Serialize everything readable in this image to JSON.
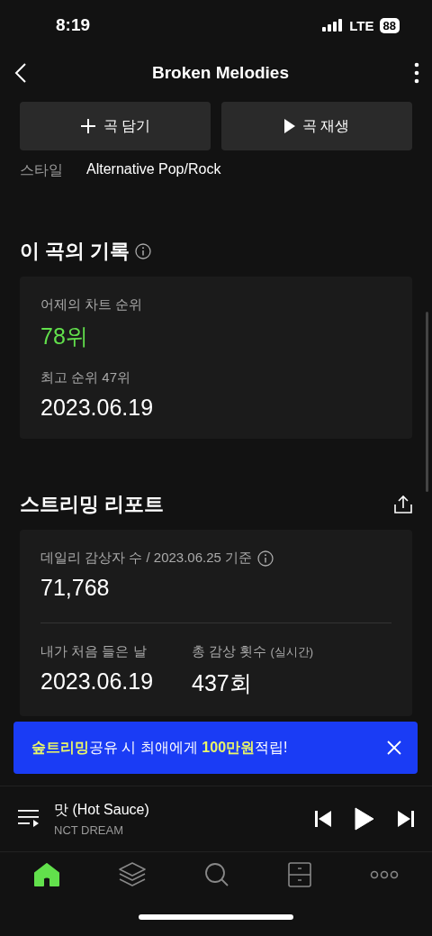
{
  "status_bar": {
    "time": "8:19",
    "network": "LTE",
    "battery": "88"
  },
  "header": {
    "title": "Broken Melodies"
  },
  "actions": [
    {
      "label": "곡 담기",
      "kind": "add"
    },
    {
      "label": "곡 재생",
      "kind": "play"
    }
  ],
  "style_row": {
    "label": "스타일",
    "value": "Alternative Pop/Rock"
  },
  "record": {
    "title": "이 곡의 기록",
    "yesterday_label": "어제의 차트 순위",
    "yesterday_rank": "78위",
    "peak_label": "최고 순위 47위",
    "peak_date": "2023.06.19"
  },
  "streaming_report": {
    "title": "스트리밍 리포트",
    "daily_label": "데일리 감상자 수 / 2023.06.25 기준",
    "daily_value": "71,768",
    "first_label": "내가 처음 들은 날",
    "first_value": "2023.06.19",
    "total_label": "총 감상 횟수",
    "total_note": "(실시간)",
    "total_value": "437회"
  },
  "banner": {
    "text": "**숲트리밍**공유 시 최애에게 **100만원**적립!"
  },
  "now_playing": {
    "title": "맛 (Hot Sauce)",
    "artist": "NCT DREAM"
  },
  "nav": [
    {
      "kind": "home",
      "selected": true
    },
    {
      "kind": "layers",
      "selected": false
    },
    {
      "kind": "search",
      "selected": false
    },
    {
      "kind": "drawer",
      "selected": false
    },
    {
      "kind": "more",
      "selected": false
    }
  ]
}
